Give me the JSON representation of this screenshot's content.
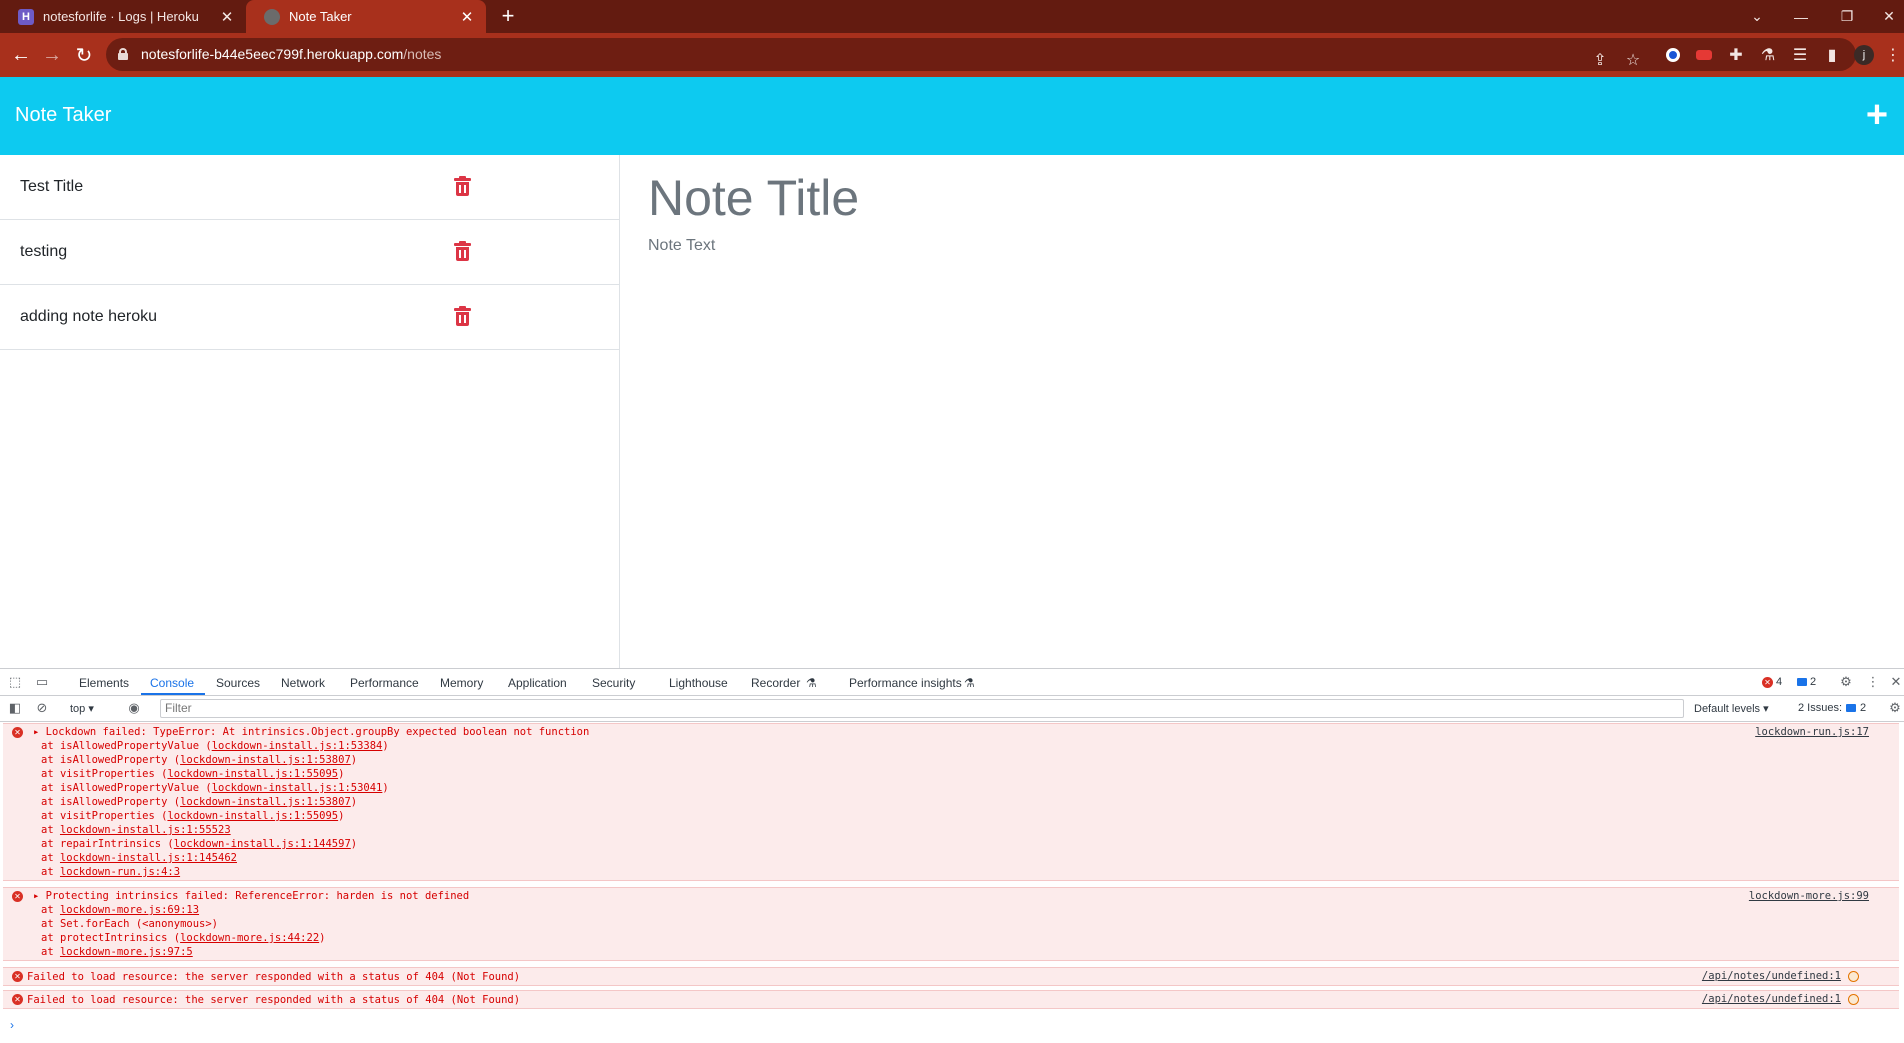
{
  "browser": {
    "tabs": [
      {
        "title": "notesforlife · Logs | Heroku",
        "favicon": "heroku-favicon",
        "active": false
      },
      {
        "title": "Note Taker",
        "favicon": "globe-favicon",
        "active": true
      }
    ],
    "url_host": "notesforlife-b44e5eec799f.herokuapp.com",
    "url_path": "/notes",
    "profile_initial": "j"
  },
  "app": {
    "brand": "Note Taker",
    "add_icon": "plus-icon",
    "notes": [
      {
        "title": "Test Title"
      },
      {
        "title": "testing"
      },
      {
        "title": "adding note heroku"
      }
    ],
    "editor": {
      "title_placeholder": "Note Title",
      "text_placeholder": "Note Text"
    },
    "colors": {
      "header": "#0dcaf0",
      "delete": "#dc3545",
      "chrome": "#a8301c"
    }
  },
  "devtools": {
    "tabs": [
      "Elements",
      "Console",
      "Sources",
      "Network",
      "Performance",
      "Memory",
      "Application",
      "Security",
      "Lighthouse",
      "Recorder",
      "Performance insights"
    ],
    "active_tab": "Console",
    "error_count": "4",
    "info_count": "2",
    "context": "top",
    "filter_placeholder": "Filter",
    "levels": "Default levels",
    "issues_label": "2 Issues:",
    "issues_count": "2",
    "messages": [
      {
        "head": "Lockdown failed: TypeError: At intrinsics.Object.groupBy expected boolean not function",
        "source": "lockdown-run.js:17",
        "stack": [
          [
            "at isAllowedPropertyValue (",
            "lockdown-install.js:1:53384",
            ")"
          ],
          [
            "at isAllowedProperty (",
            "lockdown-install.js:1:53807",
            ")"
          ],
          [
            "at visitProperties (",
            "lockdown-install.js:1:55095",
            ")"
          ],
          [
            "at isAllowedPropertyValue (",
            "lockdown-install.js:1:53041",
            ")"
          ],
          [
            "at isAllowedProperty (",
            "lockdown-install.js:1:53807",
            ")"
          ],
          [
            "at visitProperties (",
            "lockdown-install.js:1:55095",
            ")"
          ],
          [
            "at ",
            "lockdown-install.js:1:55523",
            ""
          ],
          [
            "at repairIntrinsics (",
            "lockdown-install.js:1:144597",
            ")"
          ],
          [
            "at ",
            "lockdown-install.js:1:145462",
            ""
          ],
          [
            "at ",
            "lockdown-run.js:4:3",
            ""
          ]
        ]
      },
      {
        "head": "Protecting intrinsics failed: ReferenceError: harden is not defined",
        "source": "lockdown-more.js:99",
        "stack": [
          [
            "at ",
            "lockdown-more.js:69:13",
            ""
          ],
          [
            "at Set.forEach (<anonymous>)",
            "",
            ""
          ],
          [
            "at protectIntrinsics (",
            "lockdown-more.js:44:22",
            ")"
          ],
          [
            "at ",
            "lockdown-more.js:97:5",
            ""
          ]
        ]
      },
      {
        "head": "Failed to load resource: the server responded with a status of 404 (Not Found)",
        "source": "/api/notes/undefined:1",
        "stack": []
      },
      {
        "head": "Failed to load resource: the server responded with a status of 404 (Not Found)",
        "source": "/api/notes/undefined:1",
        "stack": []
      }
    ]
  }
}
